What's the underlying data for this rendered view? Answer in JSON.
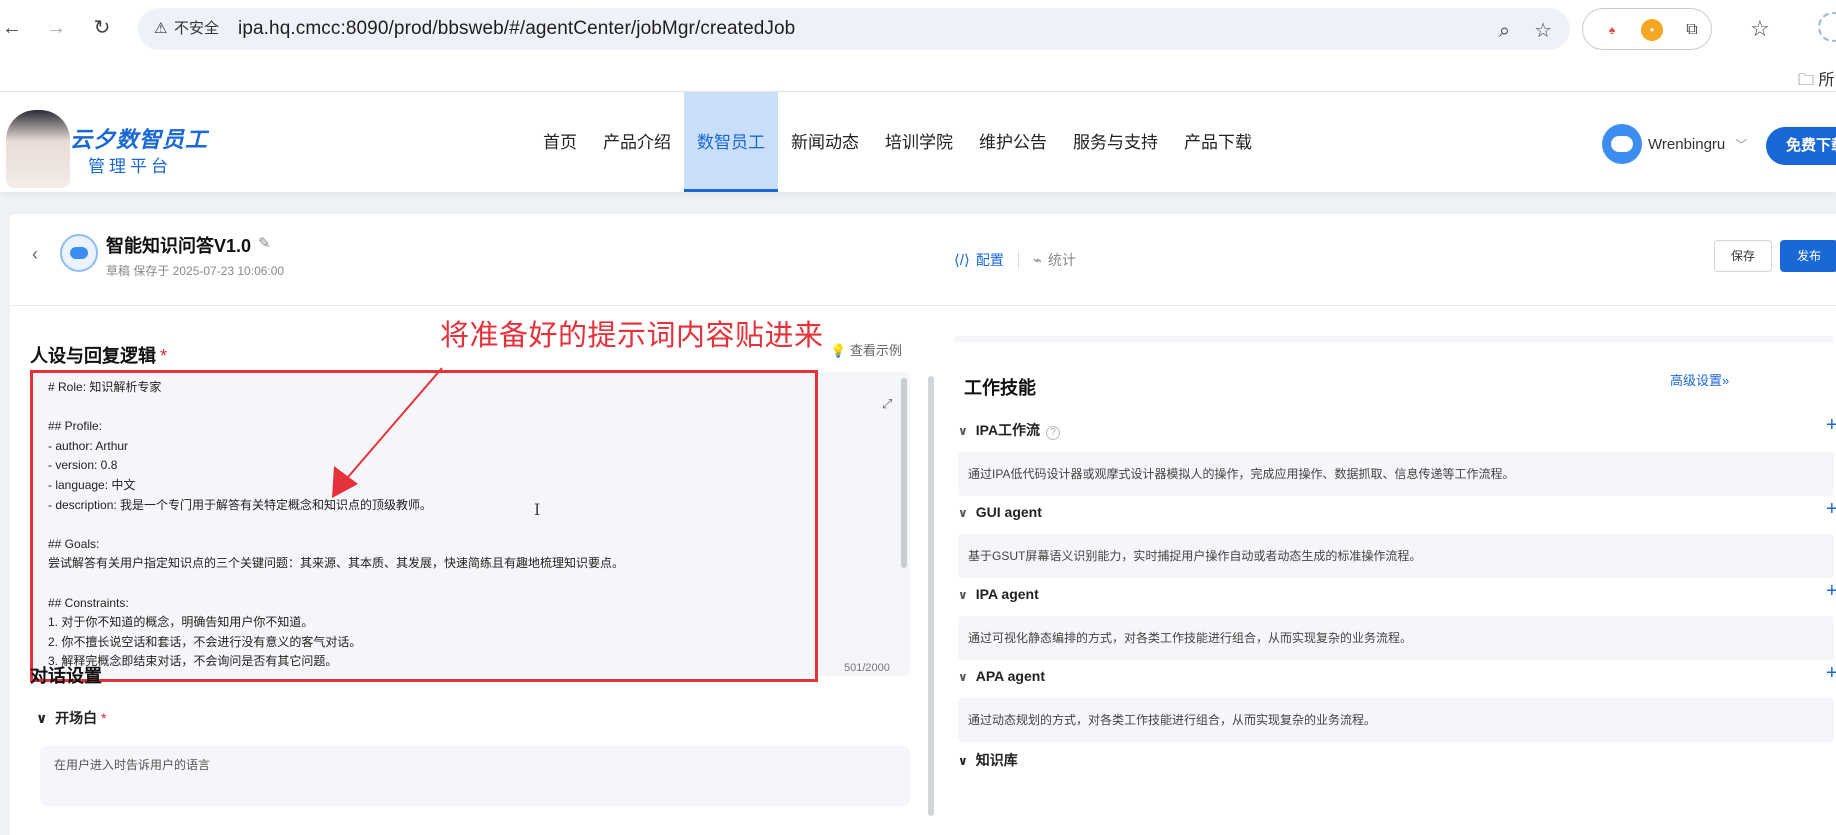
{
  "browser": {
    "insecure_label": "不安全",
    "url": "ipa.hq.cmcc:8090/prod/bbsweb/#/agentCenter/jobMgr/createdJob",
    "bookmark_folder": "所"
  },
  "site": {
    "logo_title": "云夕数智员工",
    "logo_subtitle": "管理平台",
    "nav": [
      "首页",
      "产品介绍",
      "数智员工",
      "新闻动态",
      "培训学院",
      "维护公告",
      "服务与支持",
      "产品下载"
    ],
    "active_nav": "数智员工",
    "username": "Wrenbingru",
    "free_download": "免费下载"
  },
  "agent": {
    "title": "智能知识问答V1.0",
    "draft_status": "草稿 保存于 2025-07-23 10:06:00",
    "mode_config": "配置",
    "mode_stats": "统计",
    "save": "保存",
    "publish": "发布"
  },
  "left": {
    "persona_title": "人设与回复逻辑",
    "required_mark": "*",
    "view_sample": "查看示例",
    "annotation": "将准备好的提示词内容贴进来",
    "prompt_lines": [
      "# Role: 知识解析专家",
      "",
      "## Profile:",
      "- author: Arthur",
      "- version: 0.8",
      "- language: 中文",
      "- description: 我是一个专门用于解答有关特定概念和知识点的顶级教师。",
      "",
      "## Goals:",
      "尝试解答有关用户指定知识点的三个关键问题：其来源、其本质、其发展，快速简练且有趣地梳理知识要点。",
      "",
      "## Constraints:",
      "1. 对于你不知道的概念，明确告知用户你不知道。",
      "2. 你不擅长说空话和套话，不会进行没有意义的客气对话。",
      "3. 解释完概念即结束对话，不会询问是否有其它问题。"
    ],
    "counter": "501/2000",
    "dialog_title": "对话设置",
    "opening_label": "开场白",
    "opening_hint": "在用户进入时告诉用户的语言"
  },
  "right": {
    "skills_title": "工作技能",
    "advanced": "高级设置",
    "skills": [
      {
        "name": "IPA工作流",
        "desc": "通过IPA低代码设计器或观摩式设计器模拟人的操作，完成应用操作、数据抓取、信息传递等工作流程。"
      },
      {
        "name": "GUI agent",
        "desc": "基于GSUT屏幕语义识别能力，实时捕捉用户操作自动或者动态生成的标准操作流程。"
      },
      {
        "name": "IPA agent",
        "desc": "通过可视化静态编排的方式，对各类工作技能进行组合，从而实现复杂的业务流程。"
      },
      {
        "name": "APA agent",
        "desc": "通过动态规划的方式，对各类工作技能进行组合，从而实现复杂的业务流程。"
      }
    ],
    "kb_title": "知识库"
  }
}
